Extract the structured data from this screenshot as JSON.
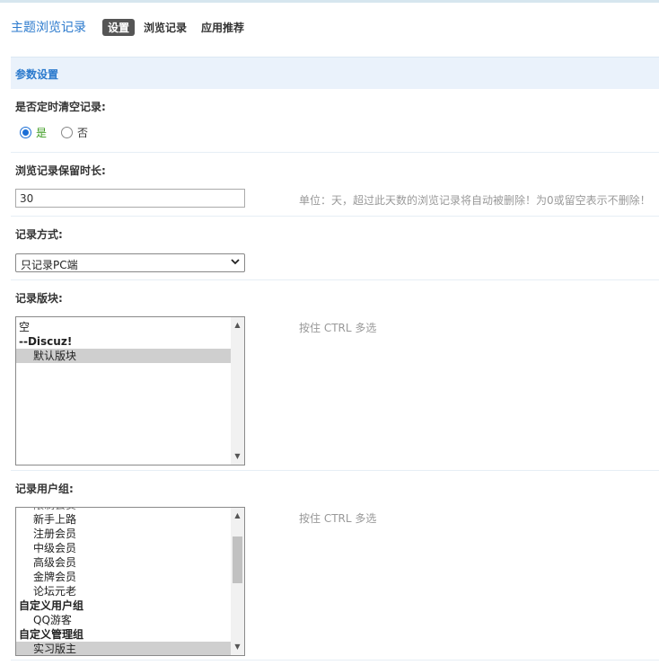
{
  "app": {
    "title": "主题浏览记录"
  },
  "tabs": [
    {
      "label": "设置"
    },
    {
      "label": "浏览记录"
    },
    {
      "label": "应用推荐"
    }
  ],
  "section": {
    "title": "参数设置"
  },
  "auto_clear": {
    "label": "是否定时清空记录:",
    "options": [
      {
        "label": "是",
        "checked": true
      },
      {
        "label": "否",
        "checked": false
      }
    ]
  },
  "retention": {
    "label": "浏览记录保留时长:",
    "value": "30",
    "hint": "单位：天，超过此天数的浏览记录将自动被删除！为0或留空表示不删除！"
  },
  "record_mode": {
    "label": "记录方式:",
    "selected": "只记录PC端"
  },
  "forums": {
    "label": "记录版块:",
    "hint": "按住 CTRL 多选",
    "options": [
      {
        "text": "空",
        "kind": "item",
        "selected": false
      },
      {
        "text": "--Discuz!",
        "kind": "group",
        "selected": false
      },
      {
        "text": "默认版块",
        "kind": "child",
        "selected": true
      }
    ]
  },
  "usergroups": {
    "label": "记录用户组:",
    "hint": "按住 CTRL 多选",
    "options": [
      {
        "text": "新手上路",
        "kind": "child",
        "selected": false
      },
      {
        "text": "注册会员",
        "kind": "child",
        "selected": false
      },
      {
        "text": "中级会员",
        "kind": "child",
        "selected": false
      },
      {
        "text": "高级会员",
        "kind": "child",
        "selected": false
      },
      {
        "text": "金牌会员",
        "kind": "child",
        "selected": false
      },
      {
        "text": "论坛元老",
        "kind": "child",
        "selected": false
      },
      {
        "text": "自定义用户组",
        "kind": "group",
        "selected": false
      },
      {
        "text": "QQ游客",
        "kind": "child",
        "selected": false
      },
      {
        "text": "自定义管理组",
        "kind": "group",
        "selected": false
      },
      {
        "text": "实习版主",
        "kind": "child",
        "selected": true
      }
    ]
  },
  "icons": {
    "dropdown": "chevron-down-icon",
    "scroll_up": "arrow-up-icon",
    "scroll_down": "arrow-down-icon"
  }
}
